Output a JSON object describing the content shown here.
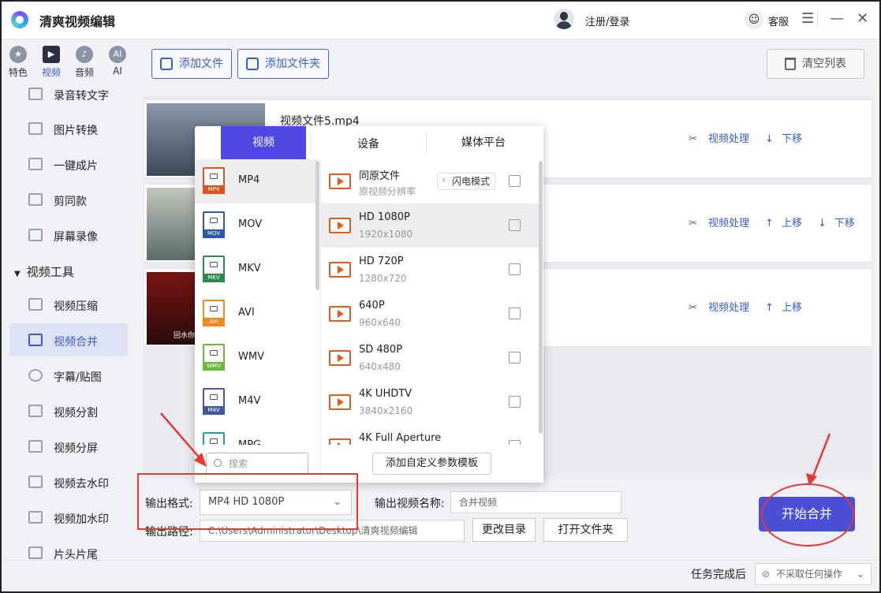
{
  "app": {
    "title": "清爽视频编辑",
    "login": "注册/登录",
    "service": "客服"
  },
  "window_controls": {
    "menu": "☰",
    "minimize": "—",
    "close": "✕"
  },
  "top_tabs": [
    {
      "label": "特色",
      "icon": "star-icon",
      "glyph": "★"
    },
    {
      "label": "视频",
      "icon": "video-icon",
      "glyph": "▶"
    },
    {
      "label": "音频",
      "icon": "music-icon",
      "glyph": "♪"
    },
    {
      "label": "AI",
      "icon": "ai-icon",
      "glyph": "AI"
    }
  ],
  "sidebar": {
    "items": [
      "录音转文字",
      "图片转换",
      "一键成片",
      "剪同款",
      "屏幕录像"
    ],
    "section": "视频工具",
    "tools": [
      "视频压缩",
      "视频合并",
      "字幕/贴图",
      "视频分割",
      "视频分屏",
      "视频去水印",
      "视频加水印",
      "片头片尾"
    ],
    "active": "视频合并"
  },
  "toolbar": {
    "add_file": "添加文件",
    "add_folder": "添加文件夹",
    "clear": "清空列表"
  },
  "files": [
    {
      "name": "视频文件5.mp4",
      "actions": [
        "视频处理",
        "下移"
      ],
      "thumb_colors": [
        "#8a98ab",
        "#3e4a5a"
      ]
    },
    {
      "name": "",
      "actions": [
        "视频处理",
        "上移",
        "下移"
      ],
      "thumb_colors": [
        "#c2c5bd",
        "#5b6b6a"
      ]
    },
    {
      "name": "",
      "actions": [
        "视频处理",
        "上移"
      ],
      "thumb_colors": [
        "#7b1414",
        "#2a0a0a"
      ],
      "thumb_caption": "回水你"
    }
  ],
  "popup": {
    "tabs": [
      "视频",
      "设备",
      "媒体平台"
    ],
    "formats": [
      {
        "name": "MP4",
        "color": "#d9541e"
      },
      {
        "name": "MOV",
        "color": "#2a5aa6"
      },
      {
        "name": "MKV",
        "color": "#2d8a4e"
      },
      {
        "name": "AVI",
        "color": "#ef8a1f"
      },
      {
        "name": "WMV",
        "color": "#6cb83a"
      },
      {
        "name": "M4V",
        "color": "#43599b"
      },
      {
        "name": "MPG",
        "color": "#1d9ea0"
      }
    ],
    "presets": [
      {
        "name": "同原文件",
        "desc": "原视频分辨率"
      },
      {
        "name": "HD 1080P",
        "desc": "1920x1080"
      },
      {
        "name": "HD 720P",
        "desc": "1280x720"
      },
      {
        "name": "640P",
        "desc": "960x640"
      },
      {
        "name": "SD 480P",
        "desc": "640x480"
      },
      {
        "name": "4K UHDTV",
        "desc": "3840x2160"
      },
      {
        "name": "4K Full Aperture",
        "desc": ""
      }
    ],
    "flash_mode": "闪电模式",
    "search_placeholder": "搜索",
    "add_template": "添加自定义参数模板"
  },
  "output": {
    "format_label": "输出格式:",
    "format_value": "MP4  HD 1080P",
    "name_label": "输出视频名称:",
    "name_value": "合并视频",
    "path_label": "输出路径:",
    "path_value": "C:\\Users\\Administrator\\Desktop\\清爽视频编辑",
    "change_dir": "更改目录",
    "open_folder": "打开文件夹",
    "start": "开始合并"
  },
  "status": {
    "after_label": "任务完成后",
    "after_value": "不采取任何操作"
  }
}
